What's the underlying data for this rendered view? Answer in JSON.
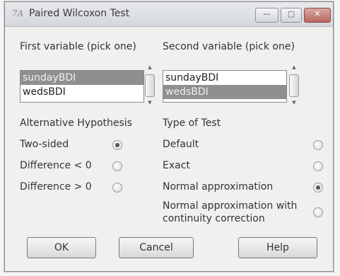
{
  "window": {
    "title": "Paired Wilcoxon Test",
    "app_icon": "7A"
  },
  "title_buttons": {
    "minimize": "—",
    "maximize": "▢",
    "close": "✕"
  },
  "first_variable": {
    "label": "First variable (pick one)",
    "items": [
      {
        "text": "sundayBDI",
        "selected": true
      },
      {
        "text": "wedsBDI",
        "selected": false
      }
    ]
  },
  "second_variable": {
    "label": "Second variable (pick one)",
    "items": [
      {
        "text": "sundayBDI",
        "selected": false
      },
      {
        "text": "wedsBDI",
        "selected": true
      }
    ]
  },
  "alternative_hypothesis": {
    "label": "Alternative Hypothesis",
    "options": [
      {
        "label": "Two-sided",
        "checked": true
      },
      {
        "label": "Difference < 0",
        "checked": false
      },
      {
        "label": "Difference > 0",
        "checked": false
      }
    ]
  },
  "type_of_test": {
    "label": "Type of Test",
    "options": [
      {
        "label": "Default",
        "checked": false
      },
      {
        "label": "Exact",
        "checked": false
      },
      {
        "label": "Normal approximation",
        "checked": true
      },
      {
        "label_line1": "Normal approximation with",
        "label_line2": "continuity correction",
        "checked": false
      }
    ]
  },
  "buttons": {
    "ok": "OK",
    "cancel": "Cancel",
    "help": "Help"
  },
  "colors": {
    "selection": "#8f8f8f",
    "close_button": "#b9675d"
  }
}
